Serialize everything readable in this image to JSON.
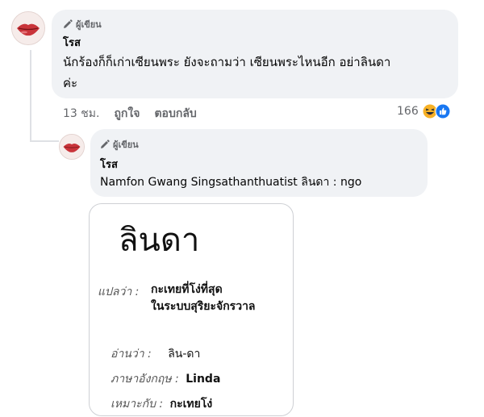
{
  "comment": {
    "badge": "ผู้เขียน",
    "author": "โรส",
    "text_line1": "นักร้องก็ก็เก่าเซียนพระ ยังจะถามว่า เซียนพระไหนอีก อย่าลินดา",
    "text_line2": "ค่ะ",
    "time": "13 ชม.",
    "like_label": "ถูกใจ",
    "reply_label": "ตอบกลับ",
    "reaction_count": "166"
  },
  "reply": {
    "badge": "ผู้เขียน",
    "author": "โรส",
    "mention": "Namfon Gwang Singsathanthuatist",
    "text": " ลินดา : ngo"
  },
  "image": {
    "word": "ลินดา",
    "meaning_label": "แปลว่า :",
    "meaning_line1": "กะเทยที่โง่ที่สุด",
    "meaning_line2": "ในระบบสุริยะจักรวาล",
    "read_label": "อ่านว่า :",
    "read_value": "ลิน-ดา",
    "english_label": "ภาษาอังกฤษ :",
    "english_value": "Linda",
    "suits_label": "เหมาะกับ :",
    "suits_value": "กะเทยโง่"
  },
  "colors": {
    "bubble": "#f0f2f5",
    "haha": "#f7b125",
    "like": "#1877f2",
    "meta": "#65676b"
  },
  "icons": [
    "pencil-icon",
    "haha-reaction-icon",
    "like-reaction-icon"
  ]
}
